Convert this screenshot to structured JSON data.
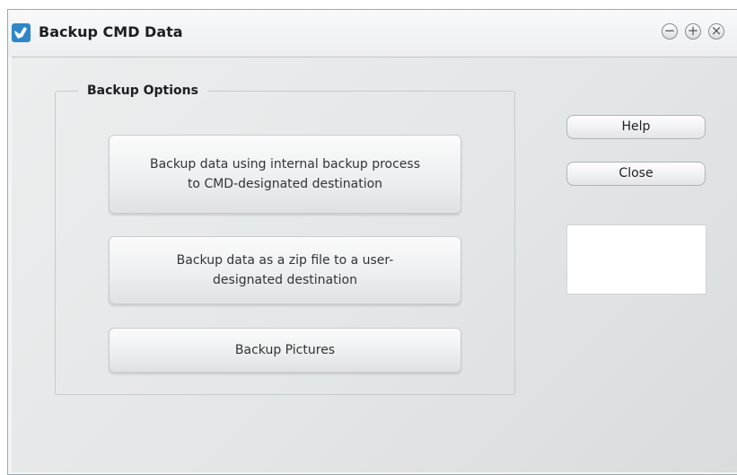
{
  "window": {
    "title": "Backup CMD Data",
    "controls": {
      "minimize_glyph": "−",
      "maximize_glyph": "+",
      "close_glyph": "×"
    }
  },
  "backup_options": {
    "label": "Backup Options",
    "buttons": [
      {
        "line1": "Backup data using internal backup process",
        "line2": "to CMD-designated destination"
      },
      {
        "line1": "Backup data as a zip file to a user-",
        "line2": "designated destination"
      },
      {
        "line1": "Backup Pictures"
      }
    ]
  },
  "side": {
    "help_label": "Help",
    "close_label": "Close"
  },
  "colors": {
    "app_icon_blue": "#2f86c8",
    "window_border": "#9fa6ad",
    "client_background": "#e3e6e7"
  },
  "icons": {
    "app": "app-logo-icon",
    "minimize": "minimize-icon",
    "maximize": "maximize-icon",
    "close": "close-icon"
  }
}
